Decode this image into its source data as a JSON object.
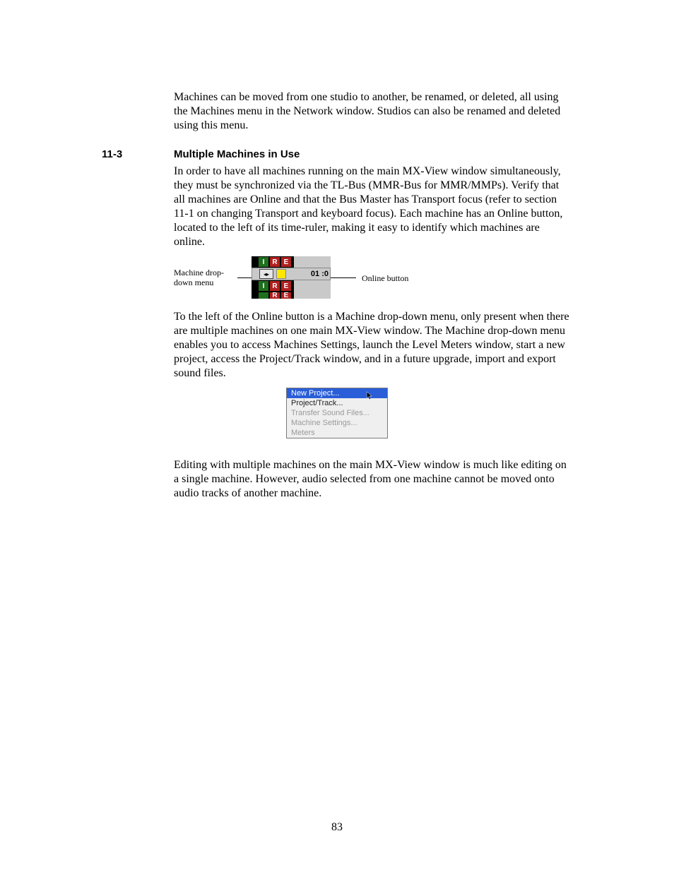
{
  "para1": "Machines can be moved from one studio to another, be renamed, or deleted, all using the Machines menu in the Network window.  Studios can also be renamed and deleted using this menu.",
  "section": {
    "num": "11-3",
    "title": "Multiple Machines in Use"
  },
  "para2": "In order to have all machines running on the main MX-View window simultaneously, they must be synchronized via the TL-Bus (MMR-Bus for MMR/MMPs). Verify that all machines are Online and that the Bus Master has Transport focus (refer to section 11-1 on changing Transport and keyboard focus). Each machine has an Online button, located to the left of its time-ruler, making it easy to identify which machines are online.",
  "fig1": {
    "left_label_l1": "Machine drop-",
    "left_label_l2": "down menu",
    "right_label": "Online button",
    "badge_I": "I",
    "badge_R": "R",
    "badge_E": "E",
    "dd_glyph": "◂▸",
    "time": "01 :0"
  },
  "para3": "To the left of the Online button is a Machine drop-down menu, only present when there are multiple machines on one main MX-View window. The Machine drop-down menu enables you to access Machines Settings, launch the Level Meters window, start a new project, access the Project/Track window, and in a future upgrade, import and export sound files.",
  "menu": {
    "items": [
      {
        "label": "New Project...",
        "state": "selected"
      },
      {
        "label": "Project/Track...",
        "state": "normal"
      },
      {
        "label": "Transfer Sound Files...",
        "state": "disabled"
      },
      {
        "label": "Machine Settings...",
        "state": "disabled"
      },
      {
        "label": "Meters",
        "state": "disabled"
      }
    ]
  },
  "para4": "Editing with multiple machines on the main MX-View window is much like editing on a single machine. However, audio selected from one machine cannot be moved onto audio tracks of another machine.",
  "page_number": "83"
}
